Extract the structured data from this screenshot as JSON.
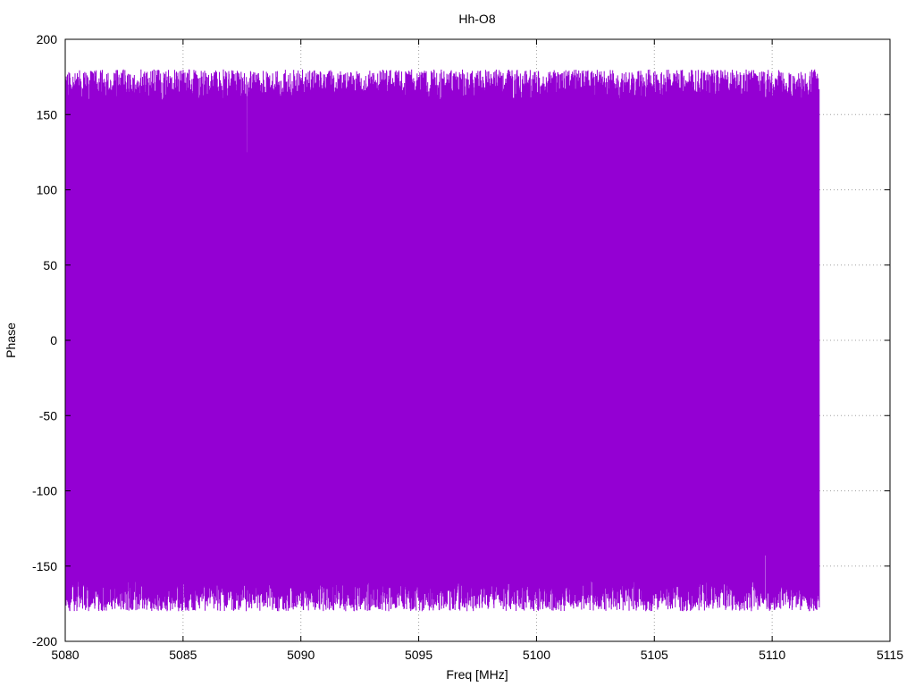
{
  "chart_data": {
    "type": "line",
    "title": "Hh-O8",
    "xlabel": "Freq [MHz]",
    "ylabel": "Phase",
    "xlim": [
      5080,
      5115
    ],
    "ylim": [
      -200,
      200
    ],
    "xticks": [
      5080,
      5085,
      5090,
      5095,
      5100,
      5105,
      5110,
      5115
    ],
    "yticks": [
      -200,
      -150,
      -100,
      -50,
      0,
      50,
      100,
      150,
      200
    ],
    "grid": true,
    "legend": "none",
    "series": [
      {
        "color": "#9400d3",
        "x_range": [
          5080,
          5112
        ],
        "value_range": [
          -180,
          180
        ],
        "note_pattern": "dense phase wrapping",
        "x": [
          5080.0,
          5080.5,
          5081.0,
          5081.5,
          5082.0,
          5082.5,
          5083.0,
          5083.5,
          5084.0,
          5084.5,
          5085.0,
          5085.5,
          5086.0,
          5086.5,
          5087.0,
          5087.5,
          5088.0,
          5088.5,
          5089.0,
          5089.5,
          5090.0,
          5090.5,
          5091.0,
          5091.5,
          5092.0,
          5092.5,
          5093.0,
          5093.5,
          5094.0,
          5094.5,
          5095.0,
          5095.5,
          5096.0,
          5096.5,
          5097.0,
          5097.5,
          5098.0,
          5098.5,
          5099.0,
          5099.5,
          5100.0,
          5100.5,
          5101.0,
          5101.5,
          5102.0,
          5102.5,
          5103.0,
          5103.5,
          5104.0,
          5104.5,
          5105.0,
          5105.5,
          5106.0,
          5106.5,
          5107.0,
          5107.5,
          5108.0,
          5108.5,
          5109.0,
          5109.5,
          5110.0,
          5110.5,
          5111.0,
          5111.5,
          5112.0
        ],
        "y": [
          170,
          -175,
          165,
          -170,
          175,
          -168,
          160,
          -178,
          172,
          -165,
          168,
          -176,
          174,
          -170,
          162,
          -179,
          176,
          -172,
          166,
          -174,
          171,
          -177,
          169,
          -166,
          175,
          -173,
          163,
          -178,
          177,
          -170,
          172,
          -169,
          168,
          -176,
          174,
          -171,
          178,
          -164,
          165,
          -175,
          173,
          -177,
          170,
          -168,
          176,
          -172,
          164,
          -179,
          171,
          -175,
          178,
          -170,
          167,
          -176,
          175,
          -172,
          169,
          -178,
          176,
          -171,
          174,
          -175,
          170,
          -177,
          167
        ]
      }
    ]
  }
}
